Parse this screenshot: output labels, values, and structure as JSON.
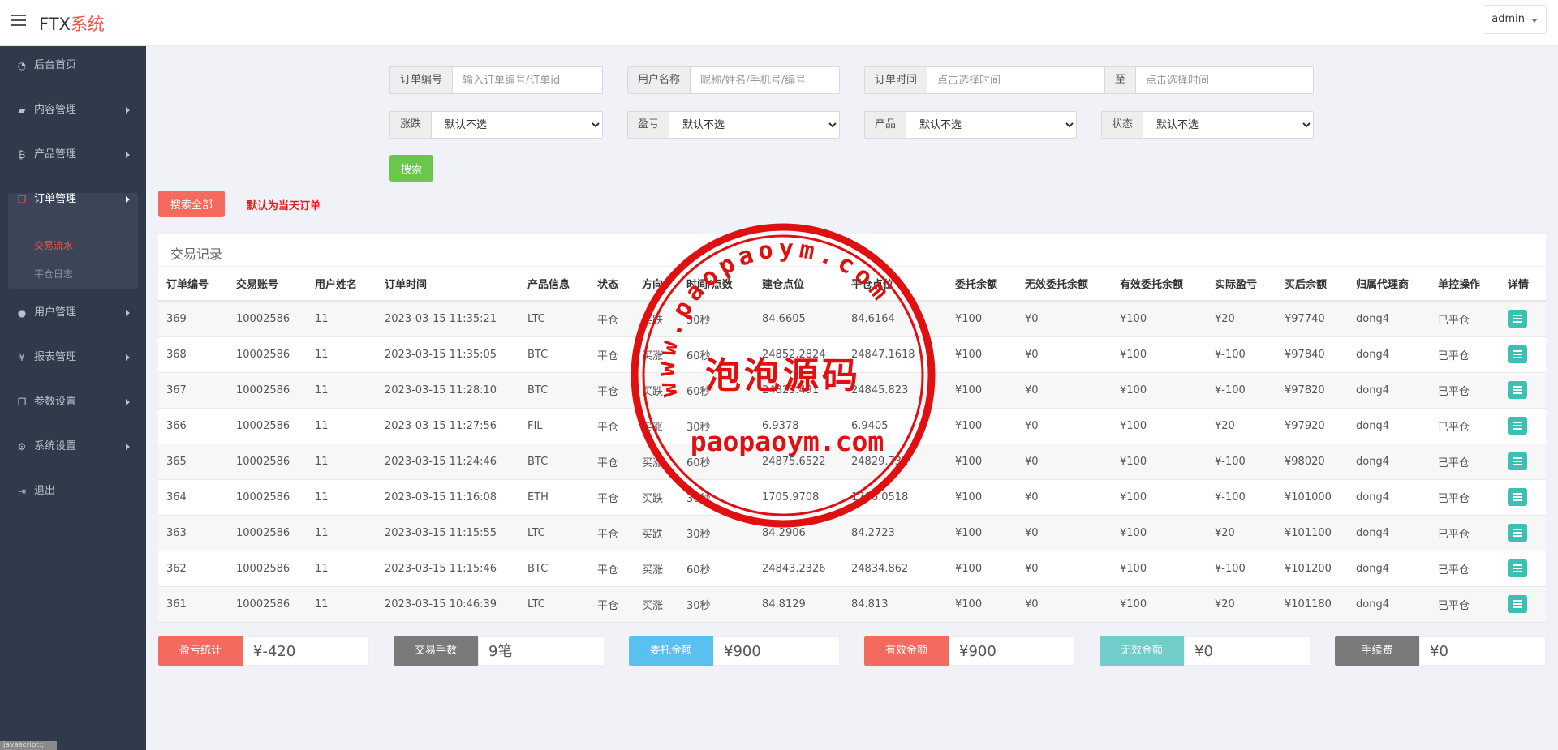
{
  "header": {
    "brand_prefix": "FTX",
    "brand_suffix": "系统",
    "user": "admin"
  },
  "sidebar": {
    "items": [
      {
        "label": "后台首页",
        "icon": "dashboard-icon"
      },
      {
        "label": "内容管理",
        "icon": "book-icon"
      },
      {
        "label": "产品管理",
        "icon": "bitcoin-icon"
      },
      {
        "label": "订单管理",
        "icon": "copy-icon"
      },
      {
        "label": "用户管理",
        "icon": "user-icon"
      },
      {
        "label": "报表管理",
        "icon": "yen-icon"
      },
      {
        "label": "参数设置",
        "icon": "copy-icon"
      },
      {
        "label": "系统设置",
        "icon": "gears-icon"
      },
      {
        "label": "退出",
        "icon": "sign-out-icon"
      }
    ],
    "sub_items": [
      {
        "label": "交易流水"
      },
      {
        "label": "平仓日志"
      }
    ],
    "corner_tag": "javascript:;"
  },
  "filters": {
    "order_no": {
      "label": "订单编号",
      "placeholder": "输入订单编号/订单id"
    },
    "user_name": {
      "label": "用户名称",
      "placeholder": "昵称/姓名/手机号/编号"
    },
    "order_time": {
      "label": "订单时间",
      "placeholder": "点击选择时间",
      "to_label": "至",
      "placeholder2": "点击选择时间"
    },
    "rise_fall": {
      "label": "涨跌",
      "value": "默认不选"
    },
    "profit_loss": {
      "label": "盈亏",
      "value": "默认不选"
    },
    "product": {
      "label": "产品",
      "value": "默认不选"
    },
    "status": {
      "label": "状态",
      "value": "默认不选"
    },
    "search_label": "搜索",
    "search_all_label": "搜索全部",
    "default_note": "默认为当天订单"
  },
  "panel": {
    "title": "交易记录",
    "columns": [
      "订单编号",
      "交易账号",
      "用户姓名",
      "订单时间",
      "产品信息",
      "状态",
      "方向",
      "时间/点数",
      "建仓点位",
      "平仓点位",
      "委托余额",
      "无效委托余额",
      "有效委托余额",
      "实际盈亏",
      "买后余额",
      "归属代理商",
      "单控操作",
      "详情"
    ],
    "rows": [
      {
        "id": "369",
        "account": "10002586",
        "name": "11",
        "time": "2023-03-15 11:35:21",
        "product": "LTC",
        "status": "平仓",
        "direction": "买跌",
        "duration": "30秒",
        "open": "84.6605",
        "close": "84.6164",
        "entrust": "¥100",
        "invalid": "¥0",
        "valid": "¥100",
        "pnl": "¥20",
        "balance": "¥97740",
        "agent": "dong4",
        "op": "已平仓"
      },
      {
        "id": "368",
        "account": "10002586",
        "name": "11",
        "time": "2023-03-15 11:35:05",
        "product": "BTC",
        "status": "平仓",
        "direction": "买涨",
        "duration": "60秒",
        "open": "24852.2824",
        "close": "24847.1618",
        "entrust": "¥100",
        "invalid": "¥0",
        "valid": "¥100",
        "pnl": "¥-100",
        "balance": "¥97840",
        "agent": "dong4",
        "op": "已平仓"
      },
      {
        "id": "367",
        "account": "10002586",
        "name": "11",
        "time": "2023-03-15 11:28:10",
        "product": "BTC",
        "status": "平仓",
        "direction": "买跌",
        "duration": "60秒",
        "open": "24823.491",
        "close": "24845.823",
        "entrust": "¥100",
        "invalid": "¥0",
        "valid": "¥100",
        "pnl": "¥-100",
        "balance": "¥97820",
        "agent": "dong4",
        "op": "已平仓"
      },
      {
        "id": "366",
        "account": "10002586",
        "name": "11",
        "time": "2023-03-15 11:27:56",
        "product": "FIL",
        "status": "平仓",
        "direction": "买涨",
        "duration": "30秒",
        "open": "6.9378",
        "close": "6.9405",
        "entrust": "¥100",
        "invalid": "¥0",
        "valid": "¥100",
        "pnl": "¥20",
        "balance": "¥97920",
        "agent": "dong4",
        "op": "已平仓"
      },
      {
        "id": "365",
        "account": "10002586",
        "name": "11",
        "time": "2023-03-15 11:24:46",
        "product": "BTC",
        "status": "平仓",
        "direction": "买涨",
        "duration": "60秒",
        "open": "24875.6522",
        "close": "24829.732",
        "entrust": "¥100",
        "invalid": "¥0",
        "valid": "¥100",
        "pnl": "¥-100",
        "balance": "¥98020",
        "agent": "dong4",
        "op": "已平仓"
      },
      {
        "id": "364",
        "account": "10002586",
        "name": "11",
        "time": "2023-03-15 11:16:08",
        "product": "ETH",
        "status": "平仓",
        "direction": "买跌",
        "duration": "30秒",
        "open": "1705.9708",
        "close": "1706.0518",
        "entrust": "¥100",
        "invalid": "¥0",
        "valid": "¥100",
        "pnl": "¥-100",
        "balance": "¥101000",
        "agent": "dong4",
        "op": "已平仓"
      },
      {
        "id": "363",
        "account": "10002586",
        "name": "11",
        "time": "2023-03-15 11:15:55",
        "product": "LTC",
        "status": "平仓",
        "direction": "买跌",
        "duration": "30秒",
        "open": "84.2906",
        "close": "84.2723",
        "entrust": "¥100",
        "invalid": "¥0",
        "valid": "¥100",
        "pnl": "¥20",
        "balance": "¥101100",
        "agent": "dong4",
        "op": "已平仓"
      },
      {
        "id": "362",
        "account": "10002586",
        "name": "11",
        "time": "2023-03-15 11:15:46",
        "product": "BTC",
        "status": "平仓",
        "direction": "买涨",
        "duration": "60秒",
        "open": "24843.2326",
        "close": "24834.862",
        "entrust": "¥100",
        "invalid": "¥0",
        "valid": "¥100",
        "pnl": "¥-100",
        "balance": "¥101200",
        "agent": "dong4",
        "op": "已平仓"
      },
      {
        "id": "361",
        "account": "10002586",
        "name": "11",
        "time": "2023-03-15 10:46:39",
        "product": "LTC",
        "status": "平仓",
        "direction": "买涨",
        "duration": "30秒",
        "open": "84.8129",
        "close": "84.813",
        "entrust": "¥100",
        "invalid": "¥0",
        "valid": "¥100",
        "pnl": "¥20",
        "balance": "¥101180",
        "agent": "dong4",
        "op": "已平仓"
      }
    ]
  },
  "summary": [
    {
      "label": "盈亏统计",
      "value": "¥-420",
      "color": "#f56a5e"
    },
    {
      "label": "交易手数",
      "value": "9笔",
      "color": "#7a7a7a"
    },
    {
      "label": "委托金额",
      "value": "¥900",
      "color": "#5bc0f0"
    },
    {
      "label": "有效金额",
      "value": "¥900",
      "color": "#f56a5e"
    },
    {
      "label": "无效金额",
      "value": "¥0",
      "color": "#72cdc9"
    },
    {
      "label": "手续费",
      "value": "¥0",
      "color": "#7a7a7a"
    }
  ],
  "watermark": {
    "arc_text": "www.paopaoym.com",
    "center_text": "泡泡源码",
    "bottom_text": "paopaoym.com"
  },
  "colors": {
    "sidebar_bg": "#2f3a4b",
    "accent_red": "#f0564b",
    "up_green": "#1a9a32",
    "down_red": "#e51c23",
    "search_green": "#69c74b",
    "detail_teal": "#3cc0b4"
  }
}
